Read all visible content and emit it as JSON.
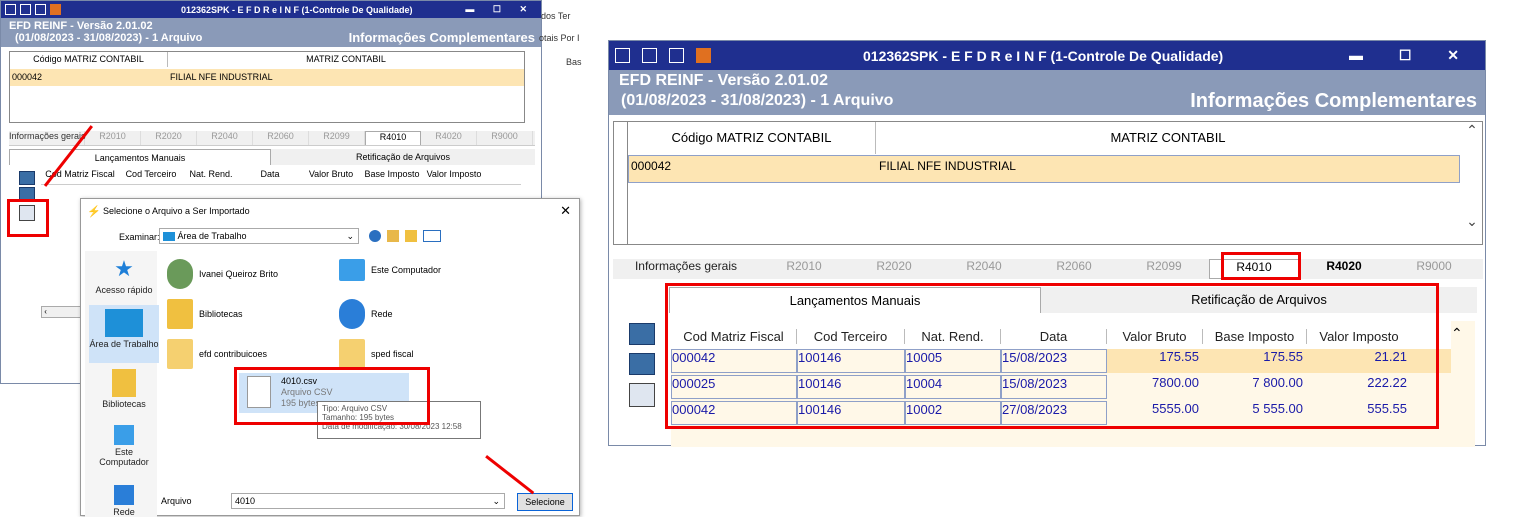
{
  "left_window": {
    "title": "012362SPK - E F D   R e I N F (1-Controle De Qualidade)",
    "app_version": "EFD REINF - Versão 2.01.02",
    "period": "(01/08/2023 - 31/08/2023) - 1 Arquivo",
    "section_title": "Informações Complementares",
    "behind_labels": [
      "dos Ter",
      "otais Por I",
      "Bas"
    ],
    "columns": [
      "Código MATRIZ CONTABIL",
      "MATRIZ CONTABIL"
    ],
    "row": {
      "code": "000042",
      "name": "FILIAL NFE INDUSTRIAL"
    },
    "tabs": [
      "Informações gerais",
      "R2010",
      "R2020",
      "R2040",
      "R2060",
      "R2099",
      "R4010",
      "R4020",
      "R9000"
    ],
    "subtabs": [
      "Lançamentos Manuais",
      "Retificação de Arquivos"
    ],
    "grid_columns": [
      "Cod Matriz Fiscal",
      "Cod Terceiro",
      "Nat. Rend.",
      "Data",
      "Valor Bruto",
      "Base Imposto",
      "Valor Imposto"
    ]
  },
  "dialog": {
    "title": "Selecione o Arquivo a Ser Importado",
    "look_in_label": "Examinar:",
    "look_in_value": "Área de Trabalho",
    "nav": [
      "Acesso rápido",
      "Área de Trabalho",
      "Bibliotecas",
      "Este Computador",
      "Rede"
    ],
    "items": [
      "Ivanei Queiroz Brito",
      "Este Computador",
      "Bibliotecas",
      "Rede",
      "efd contribuicoes",
      "sped fiscal"
    ],
    "file": {
      "name": "4010.csv",
      "type": "Arquivo CSV",
      "size": "195 bytes"
    },
    "tooltip": [
      "Tipo: Arquivo CSV",
      "Tamanho: 195 bytes",
      "Data de modificação: 30/08/2023 12:58"
    ],
    "filename_label": "Arquivo",
    "filename_value": "4010",
    "select_button": "Selecione"
  },
  "right_window": {
    "title": "012362SPK - E F D   R e I N F (1-Controle De Qualidade)",
    "app_version": "EFD REINF - Versão 2.01.02",
    "period": "(01/08/2023 - 31/08/2023) - 1 Arquivo",
    "section_title": "Informações Complementares",
    "columns": [
      "Código MATRIZ CONTABIL",
      "MATRIZ CONTABIL"
    ],
    "row": {
      "code": "000042",
      "name": "FILIAL NFE INDUSTRIAL"
    },
    "tabs": [
      "Informações gerais",
      "R2010",
      "R2020",
      "R2040",
      "R2060",
      "R2099",
      "R4010",
      "R4020",
      "R9000"
    ],
    "subtabs": [
      "Lançamentos Manuais",
      "Retificação de Arquivos"
    ],
    "grid_columns": [
      "Cod Matriz Fiscal",
      "Cod Terceiro",
      "Nat. Rend.",
      "Data",
      "Valor Bruto",
      "Base Imposto",
      "Valor Imposto"
    ],
    "rows": [
      [
        "000042",
        "100146",
        "10005",
        "15/08/2023",
        "175.55",
        "175.55",
        "21.21"
      ],
      [
        "000025",
        "100146",
        "10004",
        "15/08/2023",
        "7800.00",
        "7 800.00",
        "222.22"
      ],
      [
        "000042",
        "100146",
        "10002",
        "27/08/2023",
        "5555.00",
        "5 555.00",
        "555.55"
      ]
    ]
  },
  "colors": {
    "titlebar": "#1f2f8f",
    "header": "#8a9ab8",
    "selected_row": "#fde5b3",
    "highlight": "#e00000",
    "data_text": "#1a1aa8"
  }
}
